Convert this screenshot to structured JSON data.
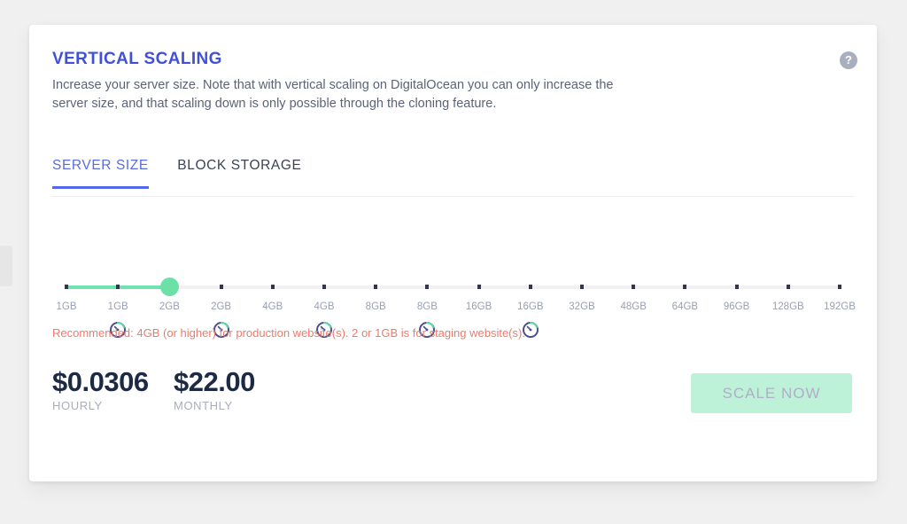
{
  "page": {
    "background_color": "#f0f0f0"
  },
  "edge_tab": {
    "name": "side-drawer-handle"
  },
  "card": {
    "help_icon": "?",
    "title": "VERTICAL SCALING",
    "description": "Increase your server size. Note that with vertical scaling on DigitalOcean you can only increase the server size, and that scaling down is only possible through the cloning feature.",
    "accent_color": "#3f51d8"
  },
  "tabs": [
    {
      "label": "SERVER SIZE",
      "active": true
    },
    {
      "label": "BLOCK STORAGE",
      "active": false
    }
  ],
  "slider": {
    "selected_index": 2,
    "selected_label": "2GB",
    "fill_color": "#6fe3ad",
    "handle_color": "#6ce0a7",
    "track_color": "#f1f1f3",
    "ticks": [
      {
        "label": "1GB",
        "gauge": false
      },
      {
        "label": "1GB",
        "gauge": true
      },
      {
        "label": "2GB",
        "gauge": false
      },
      {
        "label": "2GB",
        "gauge": true
      },
      {
        "label": "4GB",
        "gauge": false
      },
      {
        "label": "4GB",
        "gauge": true
      },
      {
        "label": "8GB",
        "gauge": false
      },
      {
        "label": "8GB",
        "gauge": true
      },
      {
        "label": "16GB",
        "gauge": false
      },
      {
        "label": "16GB",
        "gauge": true
      },
      {
        "label": "32GB",
        "gauge": false
      },
      {
        "label": "48GB",
        "gauge": false
      },
      {
        "label": "64GB",
        "gauge": false
      },
      {
        "label": "96GB",
        "gauge": false
      },
      {
        "label": "128GB",
        "gauge": false
      },
      {
        "label": "192GB",
        "gauge": false
      }
    ]
  },
  "recommendation": {
    "text": "Recommended: 4GB (or higher) for production website(s). 2 or 1GB is for staging website(s).",
    "color": "#ec7b6e"
  },
  "pricing": [
    {
      "value": "$0.0306",
      "label": "HOURLY"
    },
    {
      "value": "$22.00",
      "label": "MONTHLY"
    }
  ],
  "actions": {
    "scale_now_label": "SCALE NOW",
    "scale_now_color": "#bdf2d8"
  }
}
